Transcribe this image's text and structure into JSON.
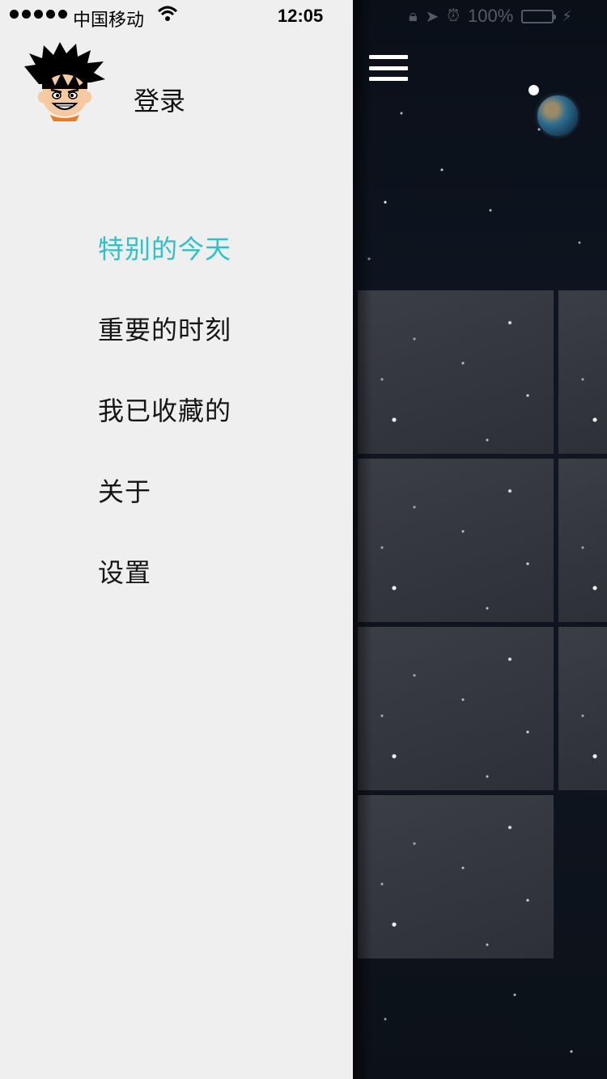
{
  "status_bar": {
    "carrier": "中国移动",
    "time": "12:05",
    "battery": "100%",
    "wifi_icon": "wifi-icon",
    "lock_icon": "orientation-lock-icon",
    "location_icon": "location-arrow-icon",
    "alarm_icon": "alarm-icon"
  },
  "drawer": {
    "avatar_icon": "avatar-goku",
    "login_label": "登录",
    "menu_items": [
      {
        "label": "特别的今天",
        "active": true
      },
      {
        "label": "重要的时刻",
        "active": false
      },
      {
        "label": "我已收藏的",
        "active": false
      },
      {
        "label": "关于",
        "active": false
      },
      {
        "label": "设置",
        "active": false
      }
    ]
  },
  "main": {
    "menu_icon": "hamburger-menu-icon",
    "decoration": "earth-and-moon",
    "tile_count": 7
  },
  "colors": {
    "accent": "#2cc2c8",
    "drawer_bg": "#efefef",
    "battery": "#4cd964"
  }
}
